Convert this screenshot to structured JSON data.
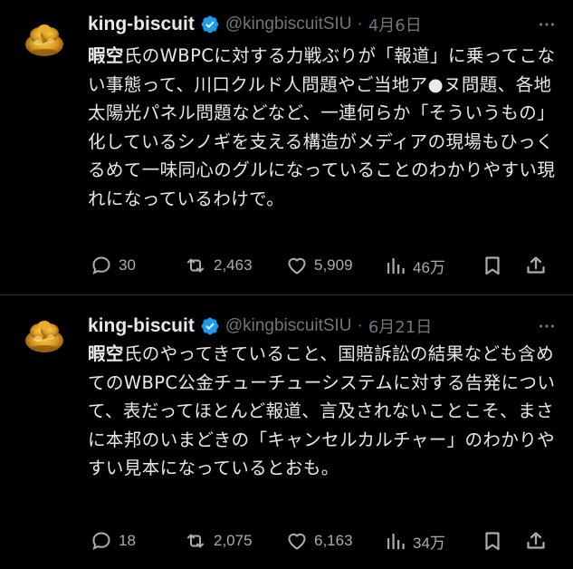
{
  "tweets": [
    {
      "display_name": "king-biscuit",
      "handle": "@kingbiscuitSIU",
      "separator": "·",
      "date": "4月6日",
      "text_bold": "暇空",
      "text_rest": "氏のWBPCに対する力戦ぶりが「報道」に乗ってこない事態って、川口クルド人問題やご当地ア●ヌ問題、各地太陽光パネル問題などなど、一連何らか「そういうもの」化しているシノギを支える構造がメディアの現場もひっくるめて一味同心のグルになっていることのわかりやすい現れになっているわけで。",
      "replies": "30",
      "retweets": "2,463",
      "likes": "5,909",
      "views": "46万"
    },
    {
      "display_name": "king-biscuit",
      "handle": "@kingbiscuitSIU",
      "separator": "·",
      "date": "6月21日",
      "text_bold": "暇空",
      "text_rest": "氏のやってきていること、国賠訴訟の結果なども含めてのWBPC公金チューチューシステムに対する告発について、表だってほとんど報道、言及されないことこそ、まさに本邦のいまどきの「キャンセルカルチャー」のわかりやすい見本になっているとおも。",
      "replies": "18",
      "retweets": "2,075",
      "likes": "6,163",
      "views": "34万"
    }
  ],
  "icons": {
    "avatar": "biscuit-avatar",
    "verified": "verified-badge-icon",
    "more": "more-icon",
    "reply": "reply-icon",
    "retweet": "retweet-icon",
    "like": "like-icon",
    "views": "views-icon",
    "bookmark": "bookmark-icon",
    "share": "share-icon"
  },
  "colors": {
    "background": "#000000",
    "text": "#e7e9ea",
    "secondary": "#71767b",
    "verified": "#1d9bf0",
    "divider": "#2f3336"
  }
}
